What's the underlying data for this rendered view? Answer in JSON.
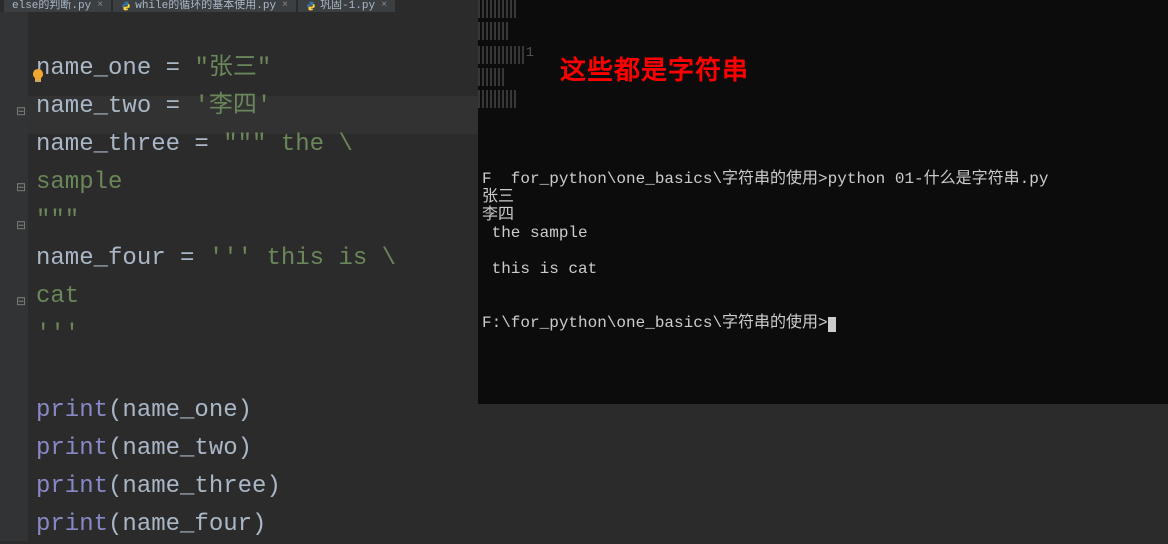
{
  "tabs": [
    {
      "label": "else的判断.py"
    },
    {
      "label": "while的循环的基本使用.py"
    },
    {
      "label": "巩固-1.py"
    }
  ],
  "code": {
    "l1a": "name_one = ",
    "l1b": "\"张三\"",
    "l2a": "name_two = ",
    "l2b": "'李四'",
    "l3a": "name_three = ",
    "l3b": "\"\"\" the \\",
    "l4": "sample",
    "l5": "\"\"\"",
    "l6a": "name_four = ",
    "l6b": "''' this is \\",
    "l7": "cat",
    "l8": "'''",
    "p1f": "print",
    "p1a": "(name_one)",
    "p2f": "print",
    "p2a": "(name_two)",
    "p3f": "print",
    "p3a": "(name_three)",
    "p4f": "print",
    "p4a": "(name_four)"
  },
  "annotation": "这些都是字符串",
  "terminal": {
    "line1": "F  for_python\\one_basics\\字符串的使用>python 01-什么是字符串.py",
    "line2": "张三",
    "line3": "李四",
    "line4": " the sample",
    "blank1": "",
    "line5": " this is cat",
    "blank2": "",
    "blank3": "",
    "line6": "F:\\for_python\\one_basics\\字符串的使用>"
  },
  "noise_num": "1"
}
